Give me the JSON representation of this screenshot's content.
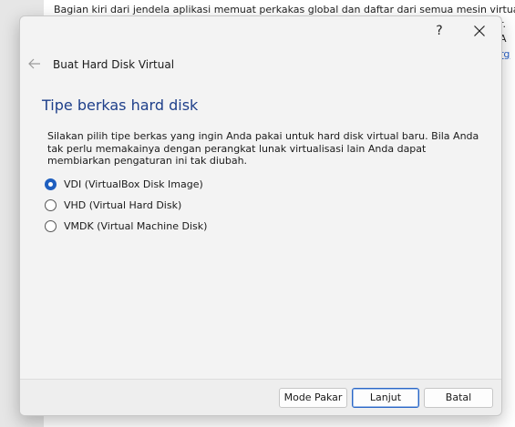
{
  "background_window": {
    "text_line": "Bagian kiri dari jendela aplikasi memuat perkakas global dan daftar dari semua mesin virtual dan grup mesin",
    "text_cont": "r. A",
    "link_fragment": "rg"
  },
  "dialog": {
    "help_label": "?",
    "title": "Buat Hard Disk Virtual",
    "page_title": "Tipe berkas hard disk",
    "description": "Silakan pilih tipe berkas yang ingin Anda pakai untuk hard disk virtual baru. Bila Anda tak perlu memakainya dengan perangkat lunak virtualisasi lain Anda dapat membiarkan pengaturan ini tak diubah.",
    "options": [
      {
        "label": "VDI (VirtualBox Disk Image)",
        "checked": true
      },
      {
        "label": "VHD (Virtual Hard Disk)",
        "checked": false
      },
      {
        "label": "VMDK (Virtual Machine Disk)",
        "checked": false
      }
    ],
    "buttons": {
      "expert": "Mode Pakar",
      "next": "Lanjut",
      "cancel": "Batal"
    }
  },
  "colors": {
    "accent": "#1f5fbf",
    "page_title": "#1e3f8a"
  }
}
